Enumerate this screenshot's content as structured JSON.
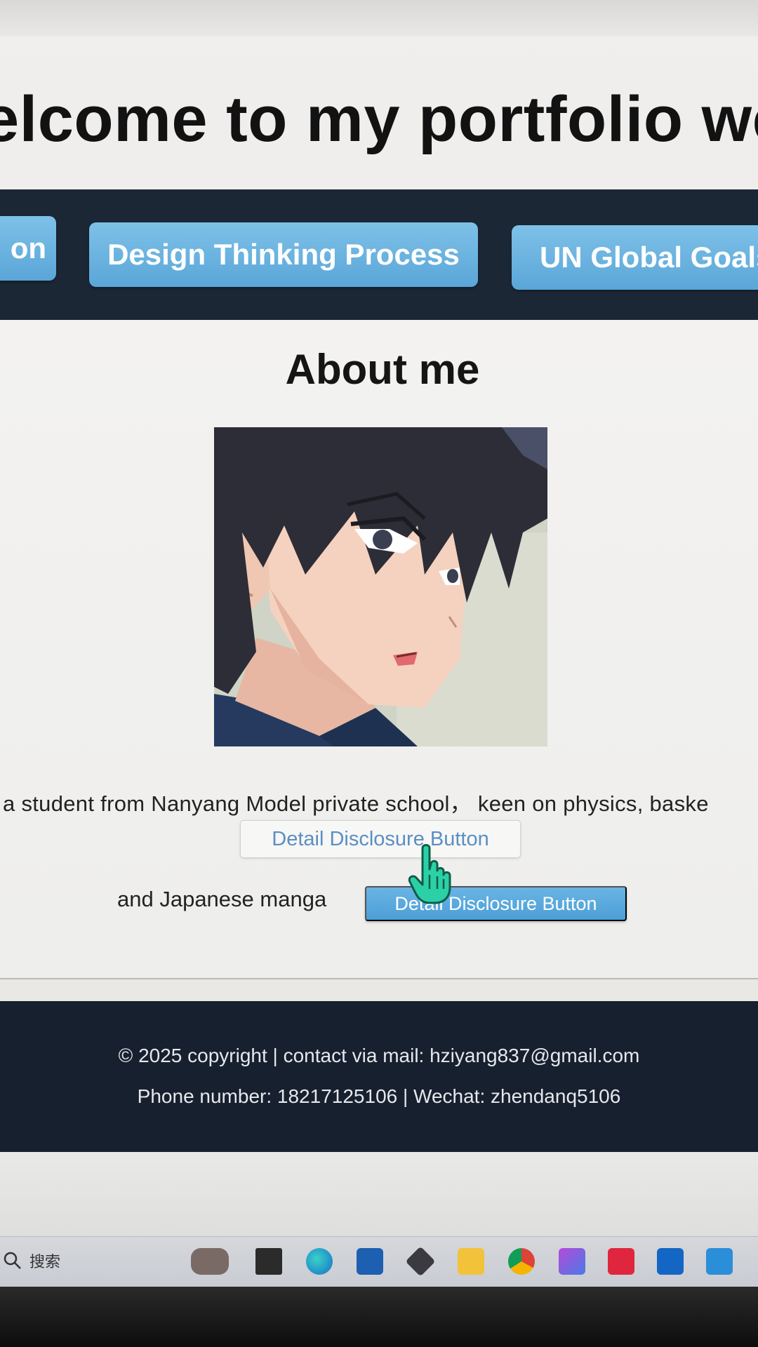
{
  "header": {
    "title": "elcome to my portfolio websi"
  },
  "nav": {
    "items": [
      {
        "label": "on"
      },
      {
        "label": "Design Thinking Process"
      },
      {
        "label": "UN Global Goals"
      }
    ]
  },
  "about": {
    "heading": "About me",
    "intro": "a student from Nanyang Model private school，  keen on physics, baske",
    "detail_button_1": "Detail Disclosure Button",
    "manga_text": "and Japanese manga",
    "detail_button_2": "Detail Disclosure Button"
  },
  "footer": {
    "line1": "© 2025 copyright | contact via mail: hziyang837@gmail.com",
    "line2": "Phone number: 18217125106 | Wechat: zhendanq5106"
  },
  "taskbar": {
    "search_label": "搜索",
    "icons": [
      "widget-icon",
      "file-manager-icon",
      "edge-icon",
      "store-icon",
      "app-icon",
      "folder-icon",
      "chrome-icon",
      "photos-icon",
      "xd-icon",
      "outlook-icon",
      "vscode-icon"
    ]
  },
  "colors": {
    "nav_bar": "#1b2735",
    "nav_button": "#6cb4e2",
    "footer": "#17202f",
    "link_blue": "#5b8fc2"
  }
}
